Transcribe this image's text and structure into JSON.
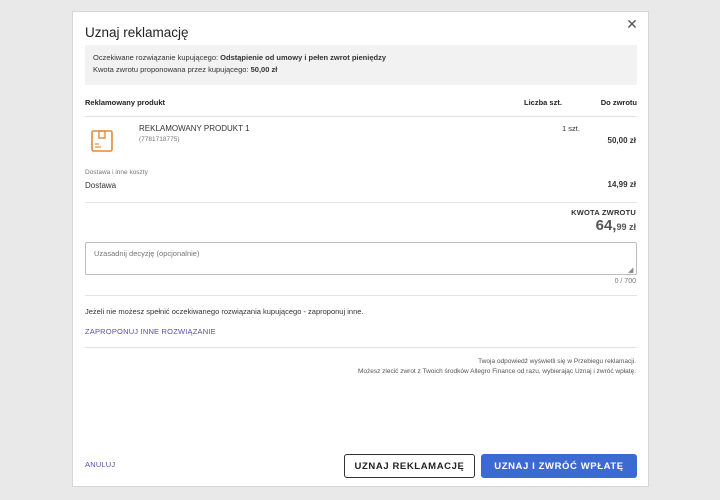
{
  "dialog": {
    "title": "Uznaj reklamację",
    "close_icon": "close-icon"
  },
  "info": {
    "expected_label": "Oczekiwane rozwiązanie kupującego: ",
    "expected_value": "Odstąpienie od umowy i pełen zwrot pieniędzy",
    "refund_label": "Kwota zwrotu proponowana przez kupującego: ",
    "refund_value": "50,00 zł"
  },
  "table": {
    "headers": {
      "product": "Reklamowany produkt",
      "quantity": "Liczba szt.",
      "refund": "Do zwrotu"
    },
    "product": {
      "icon": "package-icon",
      "name": "REKLAMOWANY PRODUKT 1",
      "id": "(7781718775)",
      "quantity": "1 szt.",
      "amount": "50,00 zł"
    },
    "costs": {
      "section_label": "Dostawa i inne koszty",
      "name": "Dostawa",
      "amount": "14,99 zł"
    }
  },
  "refund": {
    "label": "KWOTA ZWROTU",
    "amount_major": "64,",
    "amount_minor": "99 zł"
  },
  "justification": {
    "placeholder": "Uzasadnij decyzję (opcjonalnie)",
    "counter": "0  /  700"
  },
  "note": "Jeżeli nie możesz spełnić oczekiwanego rozwiązania kupującego - zaproponuj inne.",
  "propose_link": "ZAPROPONUJ INNE ROZWIĄZANIE",
  "footer": {
    "line1": "Twoja odpowiedź wyświetli się w Przebiegu reklamacji.",
    "line2": "Możesz zlecić zwrot z Twoich środków Allegro Finance od razu, wybierając Uznaj i zwróć wpłatę."
  },
  "actions": {
    "cancel": "ANULUJ",
    "accept": "UZNAJ REKLAMACJĘ",
    "accept_refund": "UZNAJ I ZWRÓĆ WPŁATĘ"
  },
  "colors": {
    "primary": "#3c6ad2",
    "link": "#5a4ea8",
    "icon_accent": "#e08a3c"
  }
}
